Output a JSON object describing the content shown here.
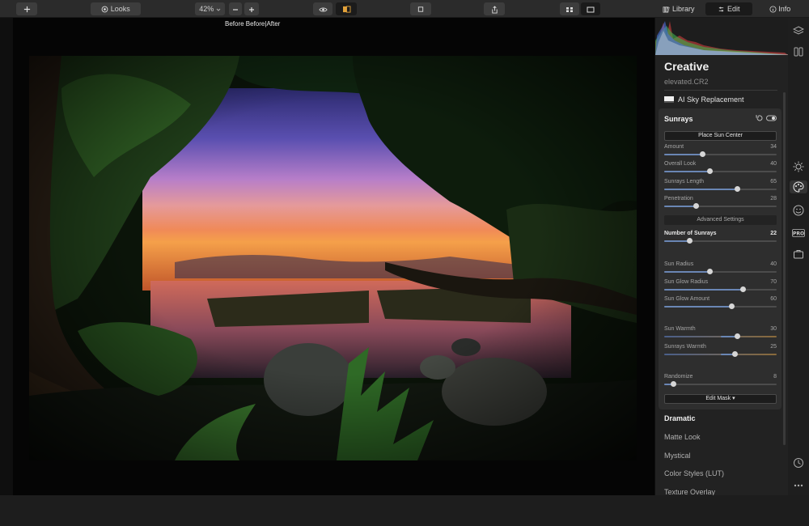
{
  "toolbar": {
    "looks_label": "Looks",
    "zoom_value": "42%",
    "tabs": {
      "library": "Library",
      "edit": "Edit",
      "info": "Info"
    }
  },
  "canvas": {
    "compare_label": "Before  Before|After"
  },
  "panel": {
    "section_title": "Creative",
    "file_name": "elevated.CR2",
    "ai_sky_label": "AI Sky Replacement",
    "sunrays": {
      "title": "Sunrays",
      "place_sun_label": "Place Sun Center",
      "advanced_label": "Advanced Settings",
      "edit_mask_label": "Edit Mask ▾",
      "sliders": [
        {
          "label": "Amount",
          "value": "34",
          "level": 34,
          "bipolar": false
        },
        {
          "label": "Overall Look",
          "value": "40",
          "level": 40,
          "bipolar": false
        },
        {
          "label": "Sunrays Length",
          "value": "65",
          "level": 65,
          "bipolar": false
        },
        {
          "label": "Penetration",
          "value": "28",
          "level": 28,
          "bipolar": false
        },
        {
          "label": "Number of Sunrays",
          "value": "22",
          "level": 22,
          "bipolar": false
        },
        {
          "label": "Sun Radius",
          "value": "40",
          "level": 40,
          "bipolar": false
        },
        {
          "label": "Sun Glow Radius",
          "value": "70",
          "level": 70,
          "bipolar": false
        },
        {
          "label": "Sun Glow Amount",
          "value": "60",
          "level": 60,
          "bipolar": false
        },
        {
          "label": "Sun Warmth",
          "value": "30",
          "level": 30,
          "bipolar": true
        },
        {
          "label": "Sunrays Warmth",
          "value": "25",
          "level": 25,
          "bipolar": true
        },
        {
          "label": "Randomize",
          "value": "8",
          "level": 8,
          "bipolar": false
        }
      ]
    },
    "presets": [
      "Dramatic",
      "Matte Look",
      "Mystical",
      "Color Styles (LUT)",
      "Texture Overlay"
    ]
  },
  "colors": {
    "accent": "#6a86b4",
    "panel_bg": "#222222",
    "toolbar_bg": "#2b2b2b"
  },
  "icons": [
    "plus-icon",
    "looks-icon",
    "zoom-out-icon",
    "zoom-in-icon",
    "eye-icon",
    "compare-icon",
    "crop-icon",
    "share-icon",
    "grid-view-icon",
    "single-view-icon",
    "library-icon",
    "edit-icon",
    "info-icon",
    "layers-icon",
    "presets-icon",
    "essentials-icon",
    "creative-icon",
    "portrait-icon",
    "pro-icon",
    "professional-icon",
    "history-icon",
    "more-icon"
  ]
}
